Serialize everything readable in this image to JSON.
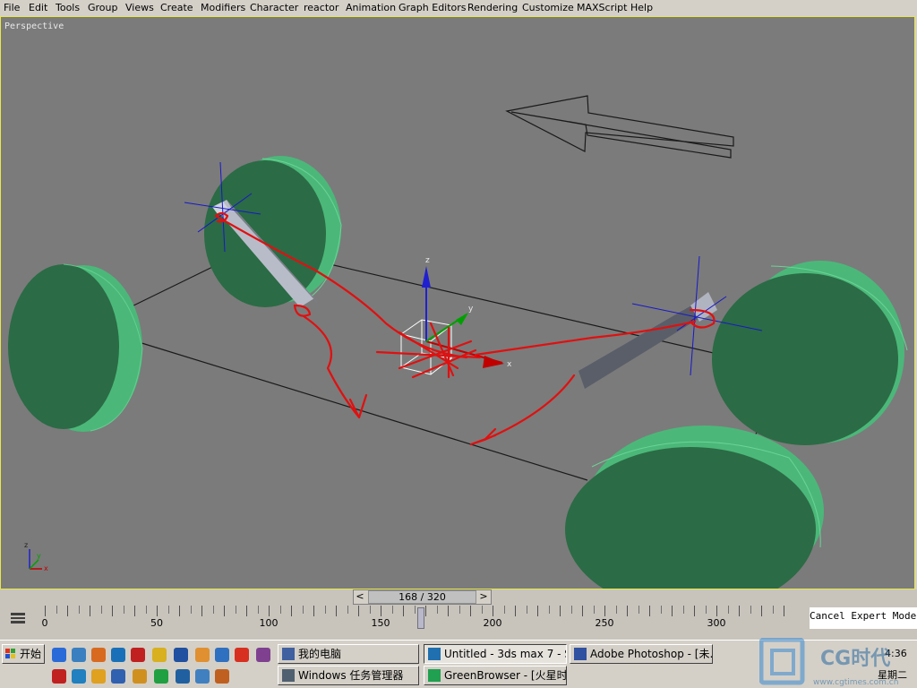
{
  "menu": [
    "File",
    "Edit",
    "Tools",
    "Group",
    "Views",
    "Create",
    "Modifiers",
    "Character",
    "reactor",
    "Animation",
    "Graph Editors",
    "Rendering",
    "Customize",
    "MAXScript",
    "Help"
  ],
  "viewport": {
    "label": "Perspective",
    "border_color": "#e8e84a",
    "bg_color": "#7b7b7b"
  },
  "gizmo": {
    "x": "x",
    "y": "y",
    "z": "z"
  },
  "axis_tripod": {
    "x": "x",
    "y": "y",
    "z": "z"
  },
  "timeline": {
    "frame_display": "168 / 320",
    "prev_label": "<",
    "next_label": ">",
    "ruler_labels": [
      "0",
      "50",
      "100",
      "150",
      "200",
      "250",
      "300"
    ],
    "current_frame": 168,
    "total_frames": 320
  },
  "status_text": "Cancel Expert Mode",
  "taskbar": {
    "start_label": "开始",
    "tasks": [
      {
        "label": "我的电脑",
        "icon": "computer-icon"
      },
      {
        "label": "Untitled - 3ds max 7 - St...",
        "icon": "3dsmax-icon"
      },
      {
        "label": "Adobe Photoshop - [未...",
        "icon": "photoshop-icon"
      },
      {
        "label": "Windows 任务管理器",
        "icon": "taskmgr-icon"
      },
      {
        "label": "GreenBrowser - [火星时...",
        "icon": "browser-icon"
      }
    ],
    "clock": "4:36",
    "day": "星期二",
    "watermark": "CG时代",
    "watermark_url": "www.cgtimes.com.cn"
  },
  "colors": {
    "wheel_face": "#2a6a44",
    "wheel_side": "#4ab878",
    "annotation": "#e01010",
    "axis_x": "#c00000",
    "axis_y": "#00a000",
    "axis_z": "#2020d0"
  }
}
